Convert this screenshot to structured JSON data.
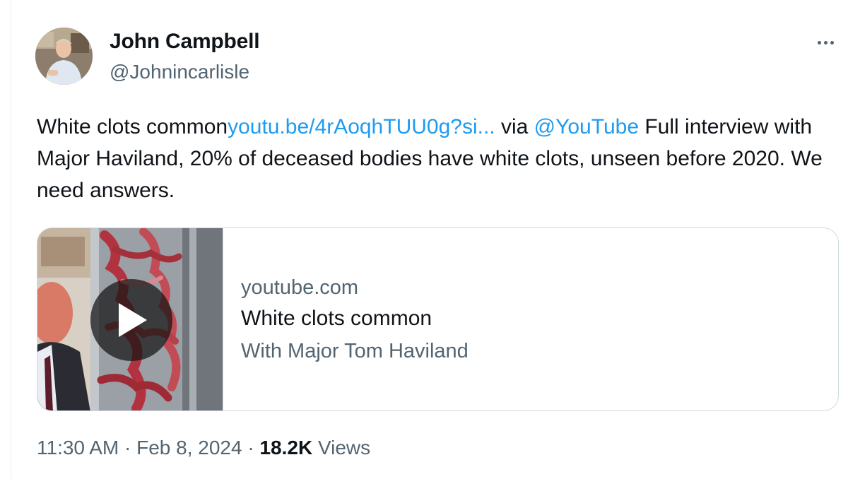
{
  "author": {
    "name": "John Campbell",
    "handle": "@Johnincarlisle"
  },
  "tweet": {
    "text_start": "White clots common",
    "link_text": "youtu.be/4rAoqhTUU0g?si...",
    "via_text": " via ",
    "mention": "@YouTube",
    "text_rest": " Full interview with Major Haviland, 20% of deceased bodies have white clots, unseen before 2020. We need answers."
  },
  "card": {
    "domain": "youtube.com",
    "title": "White clots common",
    "description": "With Major Tom Haviland",
    "thumbnail_icon": "play-icon"
  },
  "meta": {
    "time": "11:30 AM",
    "separator": " · ",
    "date": "Feb 8, 2024",
    "views_count": "18.2K",
    "views_label": " Views"
  },
  "colors": {
    "link": "#1d9bf0",
    "secondary_text": "#536471",
    "primary_text": "#0f1419",
    "border": "#cfd9de"
  }
}
